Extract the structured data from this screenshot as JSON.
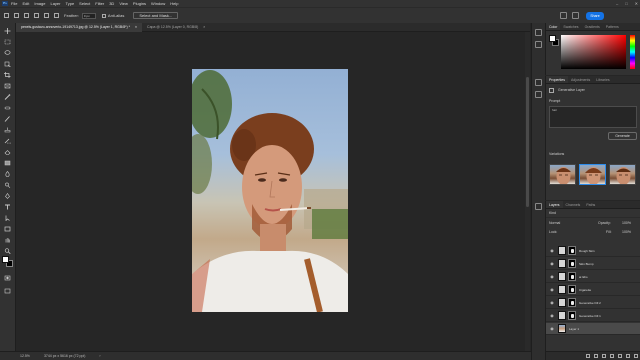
{
  "app": {
    "logo_text": "Ps"
  },
  "menu": [
    "File",
    "Edit",
    "Image",
    "Layer",
    "Type",
    "Select",
    "Filter",
    "3D",
    "View",
    "Plugins",
    "Window",
    "Help"
  ],
  "window_controls": [
    "–",
    "□",
    "✕"
  ],
  "options_bar": {
    "feather_label": "Feather:",
    "feather_value": "0 px",
    "anti_alias_label": "Anti-alias",
    "select_mask_label": "Select and Mask...",
    "share_label": "Share"
  },
  "tabs": [
    {
      "label": "pexels-gustavo-annoverio-19149713.jpg @ 12.5% (Layer 1, RGB/8*) *",
      "active": true
    },
    {
      "label": "Capa @ 12.5% (Layer 0, RGB/8)",
      "active": false
    }
  ],
  "tab_close": "×",
  "status": {
    "zoom": "12.5%",
    "doc_size": "3744 px x 5616 px (72 ppi)",
    "arrow": "›"
  },
  "color_panel": {
    "tabs": [
      "Color",
      "Swatches",
      "Gradients",
      "Patterns"
    ],
    "fg_color": "#ffffff",
    "bg_color": "#000000"
  },
  "properties_panel": {
    "tabs": [
      "Properties",
      "Adjustments",
      "Libraries"
    ],
    "layer_type": "Generative Layer",
    "prompt_label": "Prompt",
    "prompt_value": "hair",
    "generate_label": "Generate",
    "variations_label": "Variations"
  },
  "layers_panel": {
    "tabs": [
      "Layers",
      "Channels",
      "Paths"
    ],
    "kind_label": "Kind",
    "blend_mode": "Normal",
    "opacity_label": "Opacity:",
    "opacity_value": "100%",
    "lock_label": "Lock:",
    "fill_label": "Fill:",
    "fill_value": "100%",
    "layers": [
      {
        "name": "Rough Skin",
        "active": false
      },
      {
        "name": "Skin Bump",
        "active": false
      },
      {
        "name": "ai lidio",
        "active": false
      },
      {
        "name": "Cigarette",
        "active": false
      },
      {
        "name": "Generative Fill 2",
        "active": false
      },
      {
        "name": "Generative Fill 1",
        "active": false
      },
      {
        "name": "Layer 1",
        "active": true
      }
    ]
  },
  "accent_color": "#1473e6"
}
